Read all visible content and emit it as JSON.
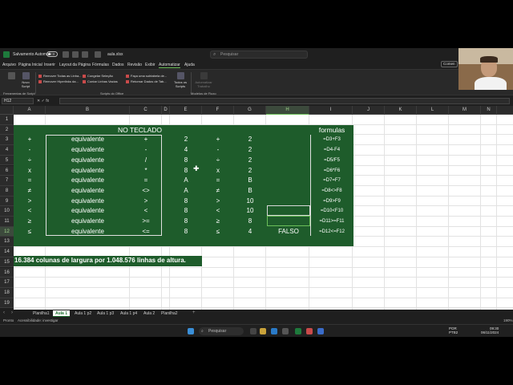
{
  "window": {
    "autosave_label": "Salvamento Automático",
    "file_name": "aula.xlsx",
    "search_placeholder": "Pesquisar",
    "comment_label": "Comen"
  },
  "menu": [
    "Arquivo",
    "Página Inicial",
    "Inserir",
    "Layout da Página",
    "Fórmulas",
    "Dados",
    "Revisão",
    "Exibir",
    "Automatizar",
    "Ajuda"
  ],
  "menu_active": "Automatizar",
  "ribbon": {
    "new_script_label": "Novo Script",
    "all_scripts_label": "Todos os Scripts",
    "automate_flow_label": "Automatizar Trabalho",
    "items": [
      "Remover Todas as Linha...",
      "Remover Hiperlinks da...",
      "Congelar Seleção",
      "Contar Linhas Vazias",
      "Faça uma subtabela de...",
      "Retornar Dados de Tab..."
    ],
    "groups": [
      "Ferramentas de Script",
      "Scripts do Office",
      "Modelos de Fluxo"
    ]
  },
  "formula_bar": {
    "name_box": "H12",
    "fx": "fx"
  },
  "columns": [
    "A",
    "B",
    "C",
    "D",
    "E",
    "F",
    "G",
    "H",
    "I",
    "J",
    "K",
    "L",
    "M",
    "N"
  ],
  "selected_column": "H",
  "rows": [
    "1",
    "2",
    "3",
    "4",
    "5",
    "6",
    "7",
    "8",
    "9",
    "10",
    "11",
    "12",
    "13",
    "14",
    "15",
    "16",
    "17",
    "18",
    "19"
  ],
  "selected_row": "12",
  "sheet": {
    "header_teclado": "NO TECLADO",
    "header_formulas": "formulas",
    "table": [
      {
        "a": "+",
        "b": "equivalente",
        "c": "+",
        "e": "2",
        "f": "+",
        "g": "2",
        "h": "",
        "i": "=D3+F3"
      },
      {
        "a": "-",
        "b": "equivalente",
        "c": "-",
        "e": "4",
        "f": "-",
        "g": "2",
        "h": "",
        "i": "=D4-F4"
      },
      {
        "a": "÷",
        "b": "equivalente",
        "c": "/",
        "e": "8",
        "f": "÷",
        "g": "2",
        "h": "",
        "i": "=D5/F5"
      },
      {
        "a": "x",
        "b": "equivalente",
        "c": "*",
        "e": "8",
        "f": "x",
        "g": "2",
        "h": "",
        "i": "=D6*F6"
      },
      {
        "a": "=",
        "b": "equivalente",
        "c": "=",
        "e": "A",
        "f": "=",
        "g": "B",
        "h": "",
        "i": "=D7=F7"
      },
      {
        "a": "≠",
        "b": "equivalente",
        "c": "<>",
        "e": "A",
        "f": "≠",
        "g": "B",
        "h": "",
        "i": "=D8<>F8"
      },
      {
        "a": ">",
        "b": "equivalente",
        "c": ">",
        "e": "8",
        "f": ">",
        "g": "10",
        "h": "",
        "i": "=D9>F9"
      },
      {
        "a": "<",
        "b": "equivalente",
        "c": "<",
        "e": "8",
        "f": "<",
        "g": "10",
        "h": "",
        "i": "=D10<F10"
      },
      {
        "a": "≥",
        "b": "equivalente",
        "c": ">=",
        "e": "8",
        "f": "≥",
        "g": "8",
        "h": "",
        "i": "=D11>=F11"
      },
      {
        "a": "≤",
        "b": "equivalente",
        "c": "<=",
        "e": "8",
        "f": "≤",
        "g": "4",
        "h": "FALSO",
        "i": "=D12<=F12"
      }
    ],
    "note": "16.384 colunas de largura por 1.048.576 linhas de altura."
  },
  "tabs": [
    "Planilha1",
    "Aula 1",
    "Aula 1 p2",
    "Aula 1 p3",
    "Aula 1 p4",
    "Aula 2",
    "Planilha2"
  ],
  "active_tab": "Aula 1",
  "status": {
    "ready": "Pronto",
    "accessibility": "Acessibilidade: investigar",
    "zoom": "190%"
  },
  "taskbar": {
    "search_placeholder": "Pesquisar",
    "lang": "POR",
    "lang2": "PTB2",
    "time": "09:30",
    "date": "06/11/2024"
  },
  "colors": {
    "accent_green": "#1e5c2b",
    "selection_green": "#6bbf59"
  }
}
